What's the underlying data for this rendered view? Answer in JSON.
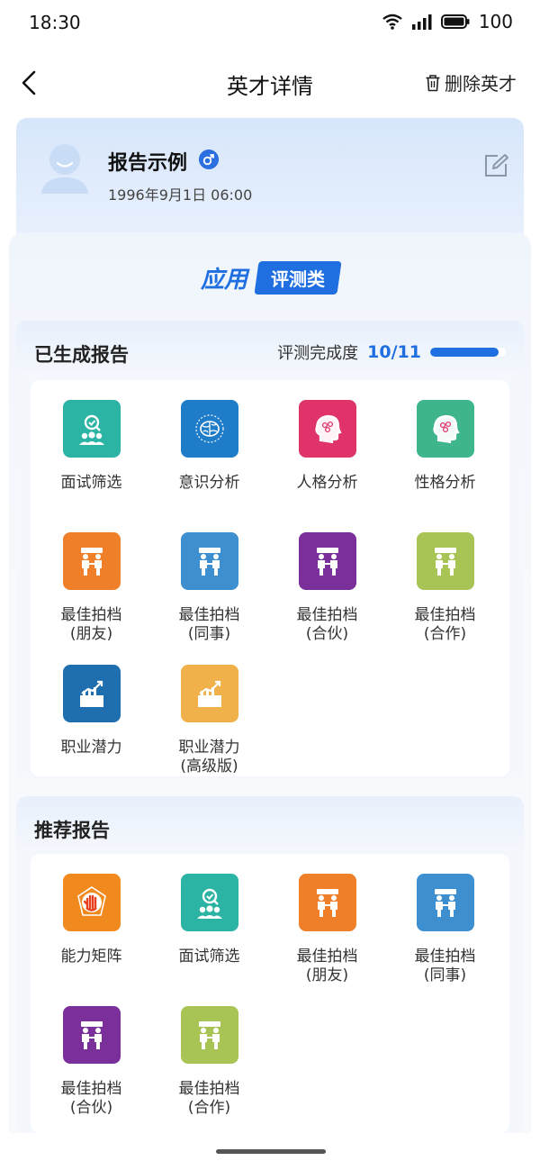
{
  "status": {
    "time": "18:30",
    "battery": "100"
  },
  "nav": {
    "title": "英才详情",
    "delete_label": "删除英才"
  },
  "profile": {
    "name": "报告示例",
    "birth": "1996年9月1日 06:00"
  },
  "app": {
    "label": "应用",
    "tab": "评测类"
  },
  "generated": {
    "title": "已生成报告",
    "progress_label": "评测完成度",
    "progress_value": "10/11",
    "progress_fraction": 0.909,
    "items": [
      {
        "label": "面试筛选",
        "sub": "",
        "color": "#2bb3a3",
        "icon": "interview-icon"
      },
      {
        "label": "意识分析",
        "sub": "",
        "color": "#1e7cc8",
        "icon": "brain-icon"
      },
      {
        "label": "人格分析",
        "sub": "",
        "color": "#e0336a",
        "icon": "head-icon"
      },
      {
        "label": "性格分析",
        "sub": "",
        "color": "#3fb58c",
        "icon": "head-icon"
      },
      {
        "label": "最佳拍档",
        "sub": "(朋友)",
        "color": "#f07f2a",
        "icon": "partner-icon"
      },
      {
        "label": "最佳拍档",
        "sub": "(同事)",
        "color": "#3d8fd0",
        "icon": "partner-icon"
      },
      {
        "label": "最佳拍档",
        "sub": "(合伙)",
        "color": "#7a2f9a",
        "icon": "partner-icon"
      },
      {
        "label": "最佳拍档",
        "sub": "(合作)",
        "color": "#a8c455",
        "icon": "partner-icon"
      },
      {
        "label": "职业潜力",
        "sub": "",
        "color": "#1e6eb0",
        "icon": "growth-icon"
      },
      {
        "label": "职业潜力",
        "sub": "(高级版)",
        "color": "#f0b04a",
        "icon": "growth-icon"
      }
    ]
  },
  "recommended": {
    "title": "推荐报告",
    "items": [
      {
        "label": "能力矩阵",
        "sub": "",
        "color": "#f08a1e",
        "icon": "hand-icon"
      },
      {
        "label": "面试筛选",
        "sub": "",
        "color": "#2bb3a3",
        "icon": "interview-icon"
      },
      {
        "label": "最佳拍档",
        "sub": "(朋友)",
        "color": "#f07f2a",
        "icon": "partner-icon"
      },
      {
        "label": "最佳拍档",
        "sub": "(同事)",
        "color": "#3d8fd0",
        "icon": "partner-icon"
      },
      {
        "label": "最佳拍档",
        "sub": "(合伙)",
        "color": "#7a2f9a",
        "icon": "partner-icon"
      },
      {
        "label": "最佳拍档",
        "sub": "(合作)",
        "color": "#a8c455",
        "icon": "partner-icon"
      }
    ]
  }
}
